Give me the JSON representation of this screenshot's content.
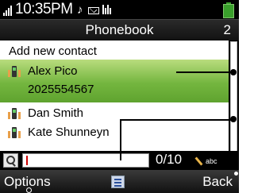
{
  "status": {
    "time": "10:35PM",
    "note_icon": "music-note"
  },
  "header": {
    "title": "Phonebook",
    "count": "2"
  },
  "list": {
    "add_label": "Add new contact",
    "contacts": [
      {
        "name": "Alex Pico",
        "number": "2025554567",
        "selected": true
      },
      {
        "name": "Dan Smith"
      },
      {
        "name": "Kate Shunneyn"
      }
    ]
  },
  "search": {
    "value": "",
    "char_count": "0/10",
    "input_mode": "abc"
  },
  "softkeys": {
    "left": "Options",
    "right": "Back"
  },
  "colors": {
    "selection": "#74b63f",
    "background": "#000000"
  }
}
